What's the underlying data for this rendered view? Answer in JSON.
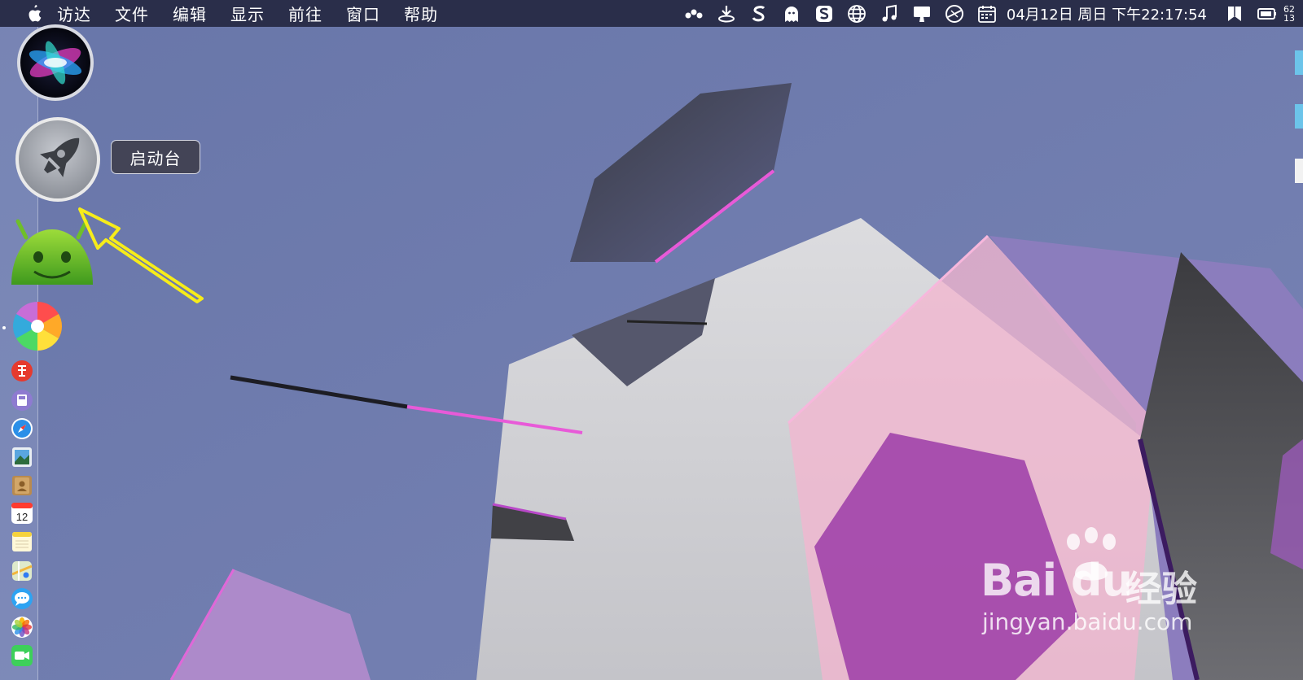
{
  "menubar": {
    "apple_icon": "apple-icon",
    "items": [
      "访达",
      "文件",
      "编辑",
      "显示",
      "前往",
      "窗口",
      "帮助"
    ],
    "status_icons": [
      "dots-icon",
      "download-icon",
      "s-app-icon",
      "ghost-icon",
      "sogou-icon",
      "globe-icon",
      "music-note-icon",
      "display-icon",
      "compass-icon",
      "calendar-icon"
    ],
    "clock": "04月12日 周日 下午22:17:54",
    "battery_text": "62 13",
    "extra_icons": [
      "bookmark-icon",
      "battery-icon"
    ]
  },
  "dock": {
    "items": [
      {
        "name": "siri",
        "icon": "siri-icon"
      },
      {
        "name": "launchpad",
        "icon": "rocket-icon"
      },
      {
        "name": "android-emulator",
        "icon": "android-icon"
      },
      {
        "name": "pinwheel-app",
        "icon": "pinwheel-icon"
      },
      {
        "name": "app-red",
        "icon": "red-app-icon"
      },
      {
        "name": "app-purple",
        "icon": "screenshot-icon"
      },
      {
        "name": "safari",
        "icon": "safari-icon"
      },
      {
        "name": "preview",
        "icon": "preview-icon"
      },
      {
        "name": "contacts",
        "icon": "contacts-icon"
      },
      {
        "name": "calendar",
        "icon": "calendar-app-icon"
      },
      {
        "name": "notes",
        "icon": "notes-icon"
      },
      {
        "name": "maps",
        "icon": "maps-icon"
      },
      {
        "name": "messages",
        "icon": "messages-icon"
      },
      {
        "name": "photos",
        "icon": "photos-icon"
      },
      {
        "name": "facetime",
        "icon": "facetime-icon"
      }
    ],
    "calendar_day": "12"
  },
  "tooltip": {
    "label": "启动台"
  },
  "annotation": {
    "arrow_color": "#f6ec1a"
  },
  "watermark": {
    "brand": "Bai du",
    "cn": "经验",
    "url": "jingyan.baidu.com"
  },
  "colors": {
    "desktop": "#6f7cae",
    "menubar": "#2a2e4a",
    "accent_pink": "#e85ad8"
  }
}
